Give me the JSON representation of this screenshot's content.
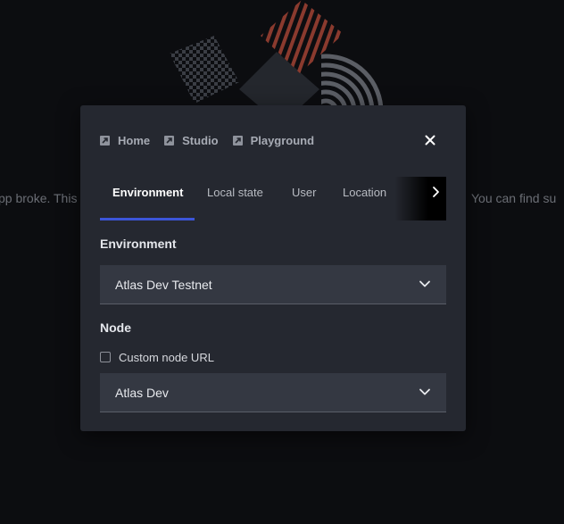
{
  "background": {
    "text_left": "pp broke. This",
    "text_right": "You can find su"
  },
  "modal": {
    "nav_links": [
      {
        "label": "Home",
        "icon": "external-link-icon"
      },
      {
        "label": "Studio",
        "icon": "external-link-icon"
      },
      {
        "label": "Playground",
        "icon": "external-link-icon"
      }
    ],
    "close_icon": "close-icon",
    "tabs": [
      {
        "label": "Environment",
        "active": true
      },
      {
        "label": "Local state",
        "active": false
      },
      {
        "label": "User",
        "active": false
      },
      {
        "label": "Location",
        "active": false
      }
    ],
    "tab_scroll_icon": "chevron-right-icon",
    "environment": {
      "label": "Environment",
      "selected": "Atlas Dev Testnet"
    },
    "node": {
      "label": "Node",
      "custom_url_label": "Custom node URL",
      "custom_url_checked": false,
      "selected": "Atlas Dev"
    }
  },
  "colors": {
    "page_bg": "#0c0d10",
    "modal_bg": "#252830",
    "select_bg": "#343842",
    "accent": "#3c55d8"
  }
}
